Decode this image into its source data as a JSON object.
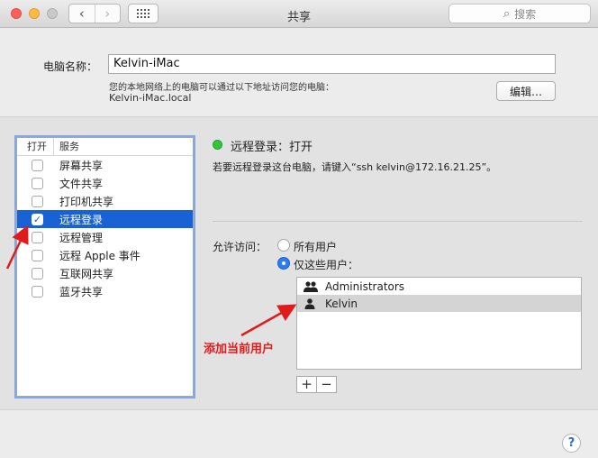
{
  "window": {
    "title": "共享"
  },
  "search": {
    "placeholder": "搜索"
  },
  "computer_name": {
    "label": "电脑名称：",
    "value": "Kelvin-iMac",
    "address_desc": "您的本地网络上的电脑可以通过以下地址访问您的电脑：",
    "address_host": "Kelvin-iMac.local",
    "edit_label": "编辑…"
  },
  "services": {
    "header_open": "打开",
    "header_service": "服务",
    "items": [
      {
        "label": "屏幕共享",
        "checked": false
      },
      {
        "label": "文件共享",
        "checked": false
      },
      {
        "label": "打印机共享",
        "checked": false
      },
      {
        "label": "远程登录",
        "checked": true,
        "selected": true
      },
      {
        "label": "远程管理",
        "checked": false
      },
      {
        "label": "远程 Apple 事件",
        "checked": false
      },
      {
        "label": "互联网共享",
        "checked": false
      },
      {
        "label": "蓝牙共享",
        "checked": false
      }
    ]
  },
  "detail": {
    "status": "远程登录：打开",
    "status_color": "#32c43a",
    "description": "若要远程登录这台电脑，请键入“ssh kelvin@172.16.21.25”。",
    "allow_label": "允许访问：",
    "option_all": "所有用户",
    "option_only": "仅这些用户：",
    "selected_option": "only"
  },
  "users": [
    {
      "name": "Administrators",
      "icon": "group-icon"
    },
    {
      "name": "Kelvin",
      "icon": "user-icon"
    }
  ],
  "buttons": {
    "add": "+",
    "remove": "−",
    "help": "?"
  },
  "annotation": {
    "text": "添加当前用户",
    "color": "#e11b1b"
  }
}
